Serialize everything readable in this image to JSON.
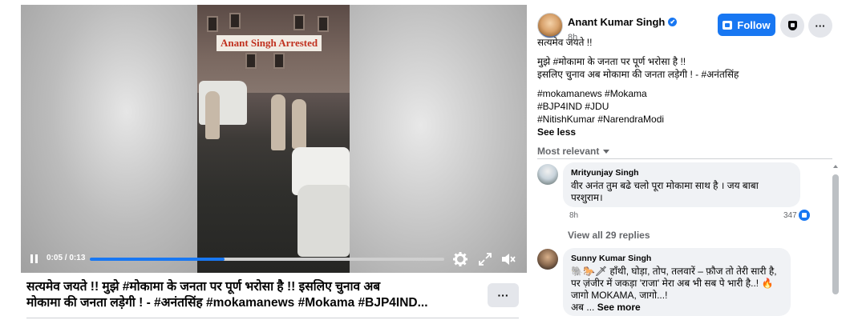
{
  "video": {
    "overlay_caption": "Anant Singh Arrested",
    "time_current": "0:05",
    "time_total": "0:13",
    "progress_fraction": 0.38,
    "icons": [
      "pause-icon",
      "settings-icon",
      "fullscreen-icon",
      "volume-muted-icon"
    ]
  },
  "video_title": {
    "line1": "सत्यमेव जयते !! मुझे #मोकामा के जनता पर पूर्ण भरोसा है !! इसलिए चुनाव अब",
    "line2": "मोकामा की जनता लड़ेगी ! - #अनंतसिंह #mokamanews #Mokama #BJP4IND...",
    "more_label": "···"
  },
  "post": {
    "author": "Anant Kumar Singh",
    "verified": "✔",
    "time": "8h · ",
    "follow_label": "Follow",
    "more_label": "···",
    "text_lines": [
      "सत्यमेव जयते !!",
      "मुझे #मोकामा के जनता पर पूर्ण भरोसा है !!",
      "इसलिए चुनाव अब मोकामा की जनता लड़ेगी ! - #अनंतसिंह"
    ],
    "hashtag_lines": [
      "#mokamanews #Mokama",
      "#BJP4IND #JDU",
      "#NitishKumar #NarendraModi"
    ],
    "see_less": "See less"
  },
  "comments_sort": "Most relevant",
  "comments": [
    {
      "name": "Mrityunjay Singh",
      "line1": "वीर अनंत तुम बढे चलो पूरा मोकामा साथ है । जय बाबा",
      "line2": "परशुराम।",
      "time": "8h",
      "likes": "347"
    },
    {
      "name": "Sunny Kumar Singh",
      "line1": "🐘🐎🗡 हाँथी, घोड़ा, तोप, तलवारें – फ़ौज तो तेरी सारी है,",
      "line2": "पर ज़ंजीर में जकड़ा 'राजा' मेरा अब भी सब पे भारी है..! 🔥",
      "line3": "जागो MOKAMA, जागो...!",
      "line4": "अब ... ",
      "see_more": "See more"
    }
  ],
  "view_replies": "View all 29 replies",
  "colors": {
    "accent": "#1877f2",
    "bubble": "#f0f2f5",
    "muted": "#65676b"
  }
}
